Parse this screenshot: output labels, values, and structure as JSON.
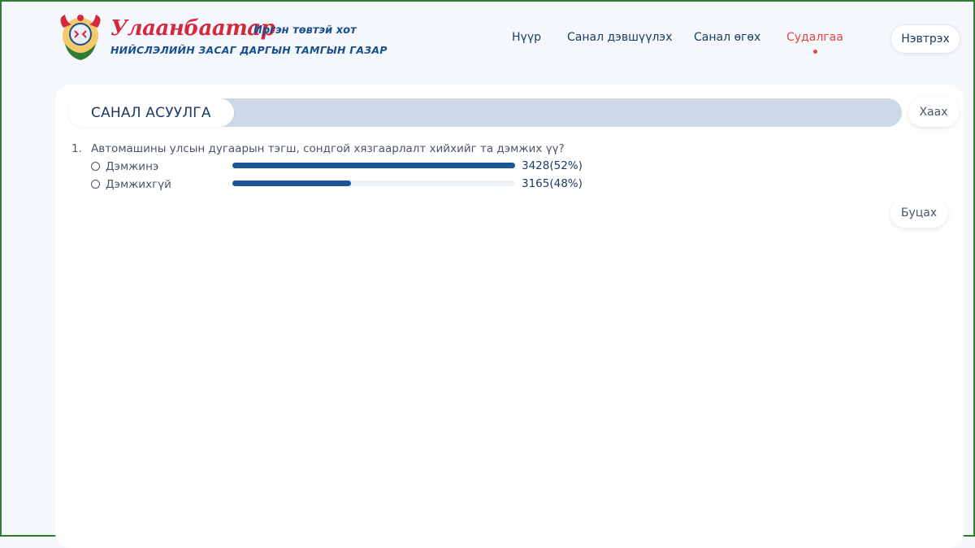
{
  "header": {
    "logo": {
      "title": "Улаанбаатар",
      "tagline": "Иргэн төвтэй хот",
      "subtitle": "НИЙСЛЭЛИЙН ЗАСАГ ДАРГЫН ТАМГЫН ГАЗАР"
    },
    "nav": [
      {
        "label": "Нүүр",
        "active": false
      },
      {
        "label": "Санал дэвшүүлэх",
        "active": false
      },
      {
        "label": "Санал өгөх",
        "active": false
      },
      {
        "label": "Судалгаа",
        "active": true
      }
    ],
    "login_label": "Нэвтрэх"
  },
  "poll": {
    "section_title": "САНАЛ АСУУЛГА",
    "close_label": "Хаах",
    "back_label": "Буцах",
    "questions": [
      {
        "number": "1.",
        "text": "Автомашины улсын дугаарын тэгш, сондгой хязгаарлалт хийхийг та дэмжих үү?",
        "options": [
          {
            "label": "Дэмжинэ",
            "result": "3428(52%)",
            "progress": 1.0
          },
          {
            "label": "Дэмжихгүй",
            "result": "3165(48%)",
            "progress": 0.42
          }
        ]
      }
    ]
  },
  "colors": {
    "accent": "#1b5597",
    "active_nav": "#e2453b",
    "brand_red": "#d6283d",
    "brand_blue": "#1a4f8f",
    "section_bar": "#cdd9e6"
  }
}
